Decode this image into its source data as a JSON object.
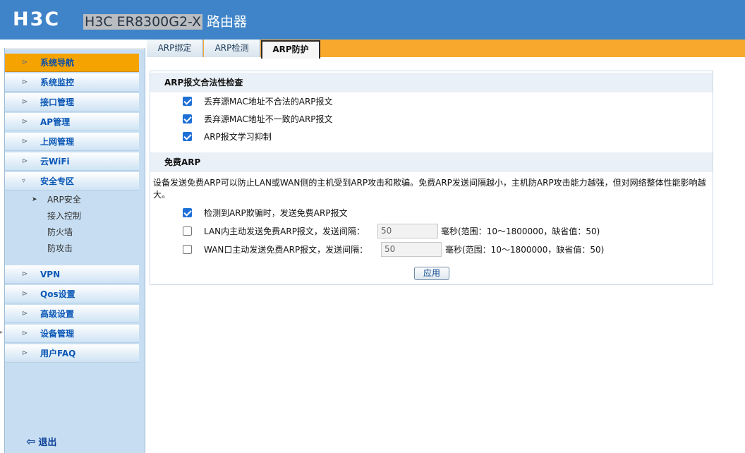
{
  "header": {
    "logo": "H3C",
    "model": "H3C ER8300G2-X",
    "product": "路由器"
  },
  "sidebar": {
    "items": [
      {
        "label": "系统导航",
        "active": true
      },
      {
        "label": "系统监控"
      },
      {
        "label": "接口管理"
      },
      {
        "label": "AP管理"
      },
      {
        "label": "上网管理"
      },
      {
        "label": "云WiFi"
      },
      {
        "label": "安全专区",
        "expanded": true
      },
      {
        "label": "VPN"
      },
      {
        "label": "Qos设置"
      },
      {
        "label": "高级设置"
      },
      {
        "label": "设备管理"
      },
      {
        "label": "用户FAQ"
      }
    ],
    "security_sub": [
      "ARP安全",
      "接入控制",
      "防火墙",
      "防攻击"
    ],
    "logout": "退出"
  },
  "tabs": [
    {
      "label": "ARP绑定"
    },
    {
      "label": "ARP检测"
    },
    {
      "label": "ARP防护",
      "active": true
    }
  ],
  "legality": {
    "title": "ARP报文合法性检查",
    "options": [
      {
        "label": "丢弃源MAC地址不合法的ARP报文",
        "checked": true
      },
      {
        "label": "丢弃源MAC地址不一致的ARP报文",
        "checked": true
      },
      {
        "label": "ARP报文学习抑制",
        "checked": true
      }
    ]
  },
  "gratuitous": {
    "title": "免费ARP",
    "description": "设备发送免费ARP可以防止LAN或WAN侧的主机受到ARP攻击和欺骗。免费ARP发送间隔越小，主机防ARP攻击能力越强，但对网络整体性能影响越大。",
    "detect": {
      "label": "检测到ARP欺骗时，发送免费ARP报文",
      "checked": true
    },
    "lan": {
      "label": "LAN内主动发送免费ARP报文，发送间隔：",
      "value": "50",
      "unit": "毫秒(范围：10～1800000，缺省值：50)",
      "checked": false
    },
    "wan": {
      "label": "WAN口主动发送免费ARP报文，发送间隔：",
      "value": "50",
      "unit": "毫秒(范围：10～1800000，缺省值：50)",
      "checked": false
    }
  },
  "apply_label": "应用"
}
